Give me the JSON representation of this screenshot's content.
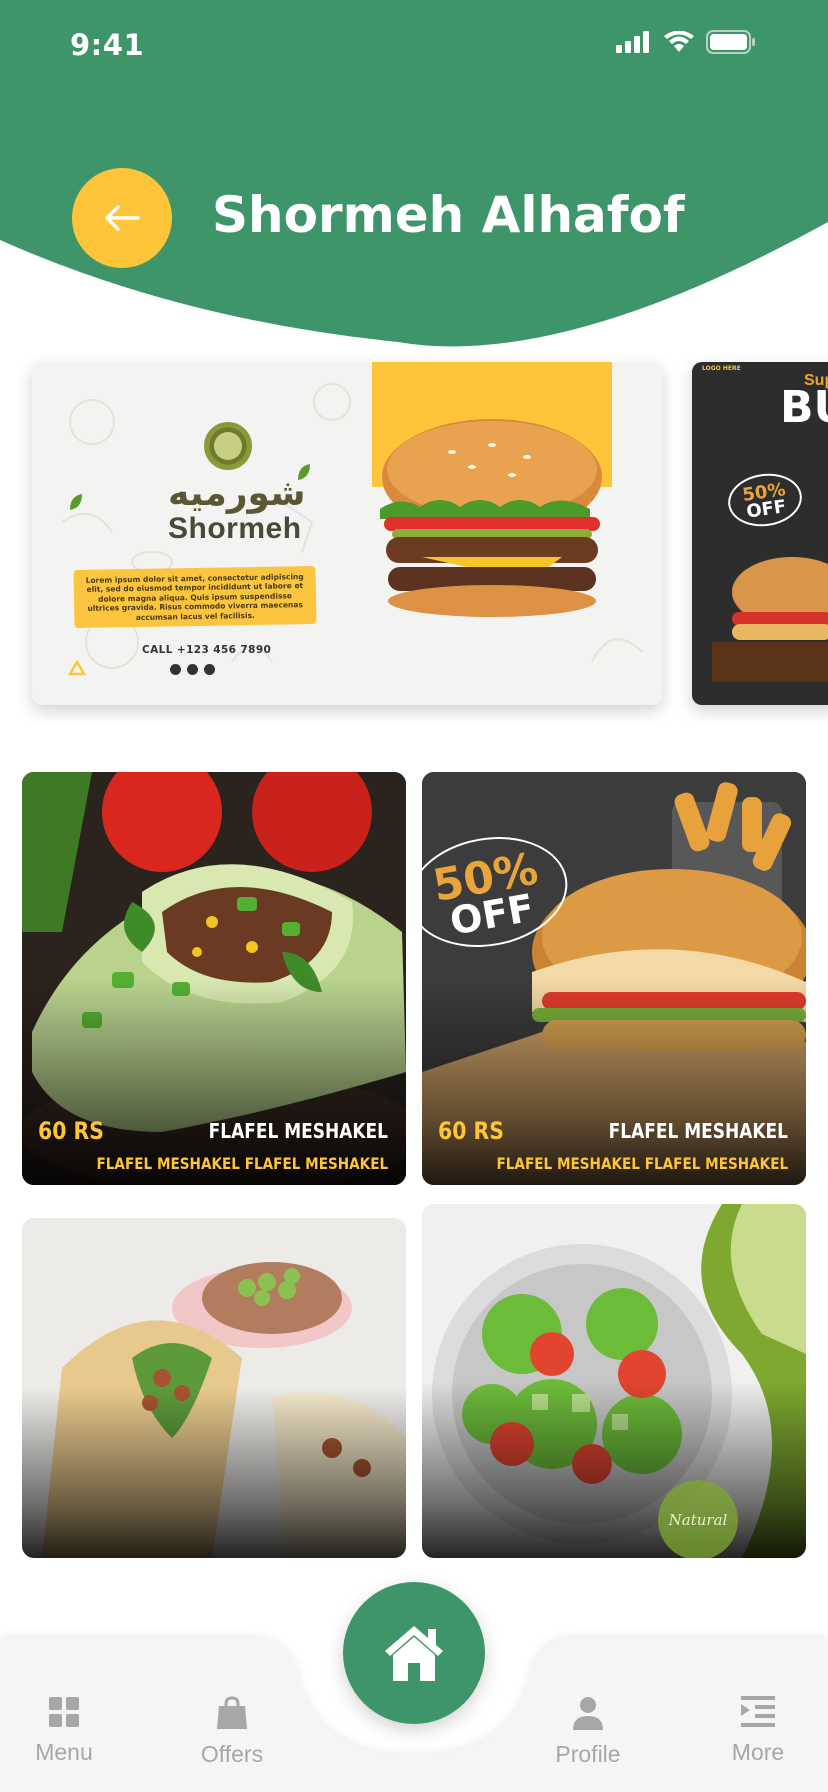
{
  "status_bar": {
    "time": "9:41"
  },
  "header": {
    "title": "Shormeh Alhafof",
    "back_icon": "arrow-left-icon"
  },
  "colors": {
    "brand_green": "#3f956a",
    "accent_yellow": "#fec43a",
    "nav_grey": "#a7a7a7"
  },
  "banners": [
    {
      "brand_ar": "شورميه",
      "brand_en": "Shormeh",
      "blurb": "Lorem ipsum dolor sit amet, consectetur adipiscing elit, sed do eiusmod tempor incididunt ut labore et dolore magna aliqua. Quis ipsum suspendisse ultrices gravida. Risus commodo viverra maecenas accumsan lacus vel facilisis.",
      "call": "CALL +123 456 7890"
    },
    {
      "logo": "LOGO HERE",
      "sup": "Sup",
      "title": "BU",
      "off_pct": "50%",
      "off_word": "OFF"
    }
  ],
  "products": [
    {
      "price": "60 RS",
      "name": "FLAFEL  MESHAKEL",
      "desc": "FLAFEL  MESHAKEL FLAFEL  MESHAKEL"
    },
    {
      "price": "60 RS",
      "name": "FLAFEL  MESHAKEL",
      "desc": "FLAFEL  MESHAKEL FLAFEL  MESHAKEL",
      "off_pct": "50%",
      "off_word": "OFF"
    },
    {
      "price": "",
      "name": "",
      "desc": ""
    },
    {
      "price": "",
      "name": "",
      "desc": "",
      "stamp": "Natural"
    }
  ],
  "bottom_nav": {
    "items": [
      {
        "label": "Menu",
        "icon": "grid-icon"
      },
      {
        "label": "Offers",
        "icon": "shopping-bag-icon"
      },
      {
        "label": "Profile",
        "icon": "user-icon"
      },
      {
        "label": "More",
        "icon": "list-icon"
      }
    ],
    "home_icon": "home-icon"
  }
}
